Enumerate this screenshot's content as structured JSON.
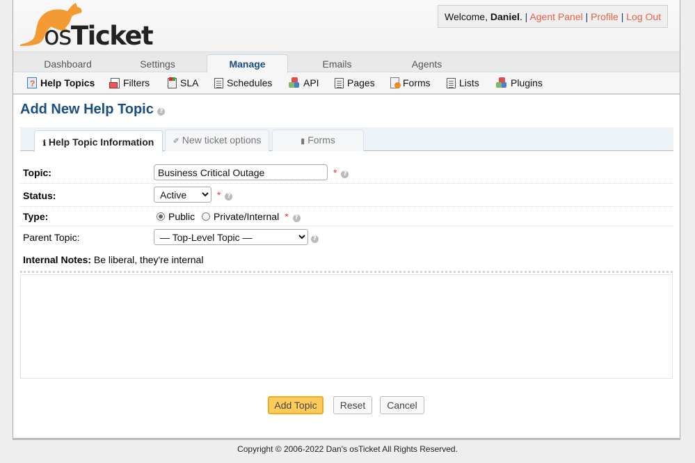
{
  "header": {
    "logo_text_prefix": "os",
    "logo_text_suffix": "Ticket",
    "welcome_prefix": "Welcome, ",
    "user_name": "Daniel",
    "welcome_suffix": ".",
    "links": [
      "Agent Panel",
      "Profile",
      "Log Out"
    ],
    "separator": "|",
    "link_color": "#e4644a"
  },
  "nav": {
    "tabs": [
      {
        "label": "Dashboard",
        "active": false
      },
      {
        "label": "Settings",
        "active": false
      },
      {
        "label": "Manage",
        "active": true
      },
      {
        "label": "Emails",
        "active": false
      },
      {
        "label": "Agents",
        "active": false
      }
    ]
  },
  "subnav": {
    "items": [
      {
        "label": "Help Topics",
        "icon": "help-topics-icon",
        "active": true
      },
      {
        "label": "Filters",
        "icon": "filters-icon"
      },
      {
        "label": "SLA",
        "icon": "sla-icon"
      },
      {
        "label": "Schedules",
        "icon": "schedules-icon"
      },
      {
        "label": "API",
        "icon": "api-icon"
      },
      {
        "label": "Pages",
        "icon": "pages-icon"
      },
      {
        "label": "Forms",
        "icon": "forms-icon"
      },
      {
        "label": "Lists",
        "icon": "lists-icon"
      },
      {
        "label": "Plugins",
        "icon": "plugins-icon"
      }
    ]
  },
  "page": {
    "title": "Add New Help Topic",
    "help_glyph": "?"
  },
  "tabs": [
    {
      "label": "Help Topic Information",
      "icon": "info-icon",
      "icon_glyph": "ℹ",
      "active": true
    },
    {
      "label": "New ticket options",
      "icon": "ticket-icon",
      "icon_glyph": "✐",
      "active": false
    },
    {
      "label": "Forms",
      "icon": "forms-tab-icon",
      "icon_glyph": "▮",
      "active": false
    }
  ],
  "form": {
    "topic": {
      "label": "Topic:",
      "value": "Business Critical Outage",
      "required": "*"
    },
    "status": {
      "label": "Status:",
      "value": "Active",
      "required": "*"
    },
    "type": {
      "label": "Type:",
      "options": [
        "Public",
        "Private/Internal"
      ],
      "selected": "Public",
      "required": "*"
    },
    "parent_topic": {
      "label": "Parent Topic:",
      "value": "— Top-Level Topic —"
    },
    "internal_notes": {
      "label": "Internal Notes:",
      "hint": "Be liberal, they're internal",
      "value": ""
    }
  },
  "buttons": {
    "submit": "Add Topic",
    "reset": "Reset",
    "cancel": "Cancel"
  },
  "footer": {
    "copyright": "Copyright © 2006-2022 Dan's osTicket All Rights Reserved."
  }
}
